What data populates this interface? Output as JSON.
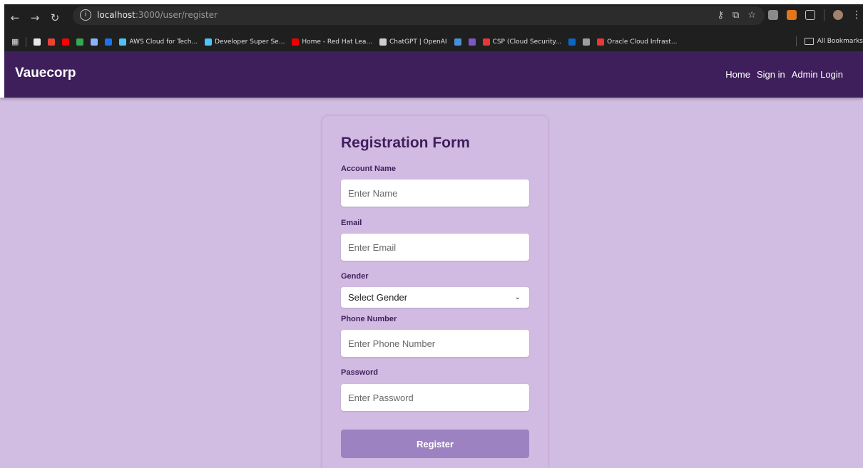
{
  "browser": {
    "url_host": "localhost",
    "url_path": ":3000/user/register",
    "bookmarks": [
      {
        "label": "",
        "color": "#e8e8e8"
      },
      {
        "label": "",
        "color": "#ea4335"
      },
      {
        "label": "",
        "color": "#ff0000"
      },
      {
        "label": "",
        "color": "#34a853"
      },
      {
        "label": "",
        "color": "#8ab4f8"
      },
      {
        "label": "",
        "color": "#1a73e8"
      },
      {
        "label": "AWS Cloud for Tech...",
        "color": "#4fc3f7"
      },
      {
        "label": "Developer Super Se...",
        "color": "#4fc3f7"
      },
      {
        "label": "Home - Red Hat Lea...",
        "color": "#ee0000"
      },
      {
        "label": "ChatGPT | OpenAI",
        "color": "#cfcfcf"
      },
      {
        "label": "",
        "color": "#4a90d9"
      },
      {
        "label": "",
        "color": "#7e57c2"
      },
      {
        "label": "CSP (Cloud Security...",
        "color": "#e53935"
      },
      {
        "label": "",
        "color": "#0a66c2"
      },
      {
        "label": "",
        "color": "#9e9e9e"
      },
      {
        "label": "Oracle Cloud Infrast...",
        "color": "#e53935"
      }
    ],
    "all_bookmarks_label": "All Bookmarks"
  },
  "header": {
    "brand": "Vauecorp",
    "nav": [
      "Home",
      "Sign in",
      "Admin Login"
    ]
  },
  "form": {
    "title": "Registration Form",
    "name_label": "Account Name",
    "name_placeholder": "Enter Name",
    "email_label": "Email",
    "email_placeholder": "Enter Email",
    "gender_label": "Gender",
    "gender_value": "Select Gender",
    "phone_label": "Phone Number",
    "phone_placeholder": "Enter Phone Number",
    "password_label": "Password",
    "password_placeholder": "Enter Password",
    "submit_label": "Register"
  },
  "colors": {
    "header_bg": "#3f1f5b",
    "page_bg": "#d2bde2",
    "button_bg": "#9d82c1"
  }
}
